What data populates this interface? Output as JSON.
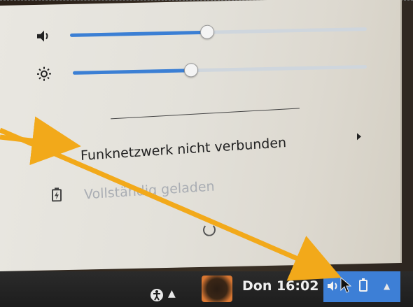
{
  "menu": {
    "volume_level": 0.46,
    "brightness_level": 0.4,
    "network_label": "Funknetzwerk nicht verbunden",
    "battery_label": "Vollständig geladen"
  },
  "taskbar": {
    "clock": "Don 16:02"
  },
  "colors": {
    "slider_fill": "#3b7fd4",
    "annotation_arrow": "#f2a91a",
    "tray_highlight": "#3d7fd6"
  },
  "icons": {
    "volume": "speaker-icon",
    "brightness": "sun-icon",
    "battery": "battery-icon",
    "submenu": "triangle-right-icon",
    "accessibility": "accessibility-icon",
    "keyboard": "chevron-up-icon",
    "tray_volume": "speaker-icon",
    "tray_battery": "battery-icon",
    "tray_menu": "triangle-up-icon",
    "cursor": "mouse-pointer-icon"
  }
}
